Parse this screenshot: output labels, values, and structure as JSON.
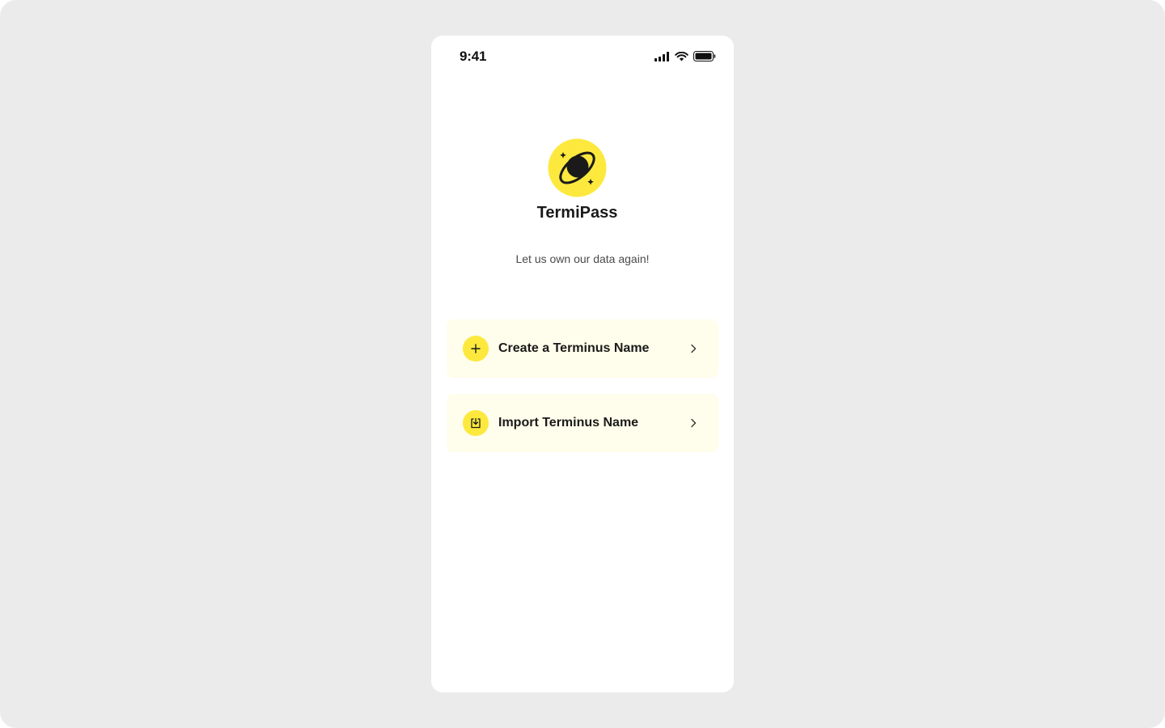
{
  "status_bar": {
    "time": "9:41",
    "icons": [
      "signal-icon",
      "wifi-icon",
      "battery-icon"
    ]
  },
  "app": {
    "name": "TermiPass",
    "tagline": "Let us own our data again!",
    "logo_icon": "planet-icon",
    "brand_color": "#FDE93E",
    "card_background": "#FFFDEB"
  },
  "actions": [
    {
      "label": "Create a Terminus Name",
      "icon": "plus-icon"
    },
    {
      "label": "Import Terminus Name",
      "icon": "import-icon"
    }
  ]
}
